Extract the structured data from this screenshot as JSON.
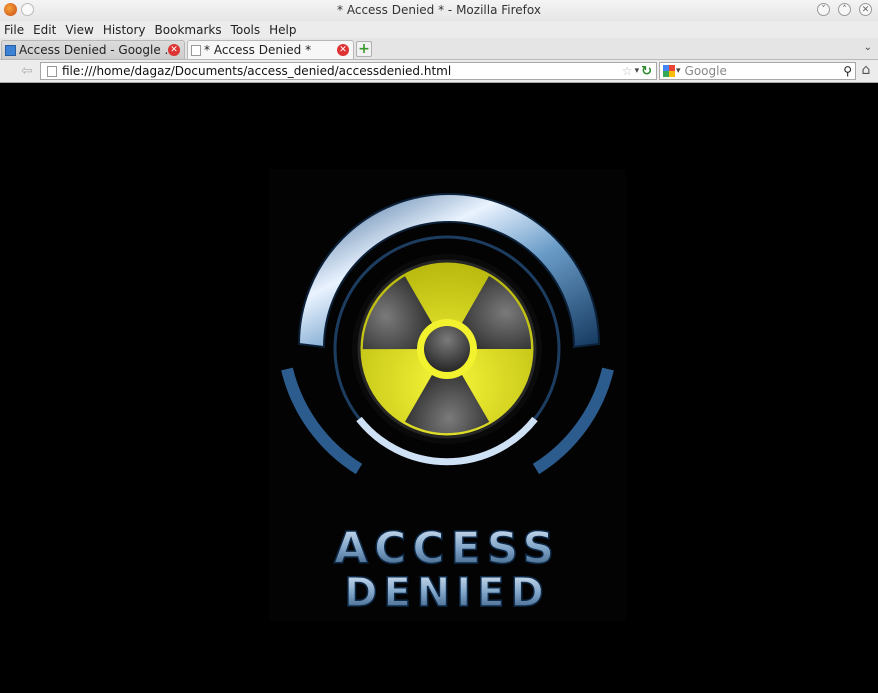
{
  "window": {
    "title": "* Access Denied * - Mozilla Firefox",
    "controls": [
      "minimize",
      "maximize",
      "close"
    ]
  },
  "menu": {
    "items": [
      "File",
      "Edit",
      "View",
      "History",
      "Bookmarks",
      "Tools",
      "Help"
    ]
  },
  "tabs": [
    {
      "label": "Access Denied - Google ...",
      "icon": "doc-icon",
      "active": false
    },
    {
      "label": "* Access Denied *",
      "icon": "blank-page-icon",
      "active": true
    }
  ],
  "navigation": {
    "url": "file:///home/dagaz/Documents/access_denied/accessdenied.html",
    "search_engine": "Google",
    "search_placeholder": "Google"
  },
  "page": {
    "background": "#000000",
    "logo_text_line1": "ACCESS",
    "logo_text_line2": "DENIED",
    "symbol": "radiation-trefoil",
    "accent_color": "#e8e81a"
  }
}
